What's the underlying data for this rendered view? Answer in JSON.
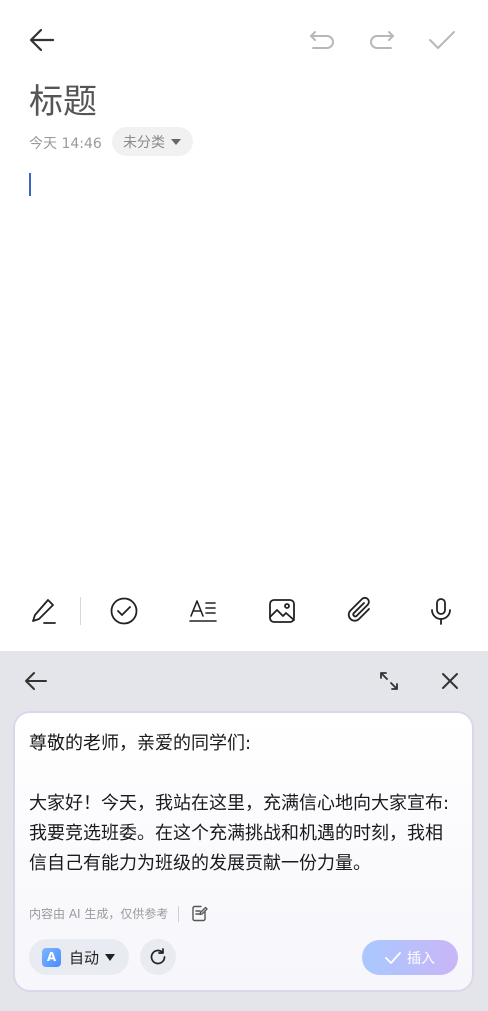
{
  "header": {
    "back_icon": "arrow-left-icon",
    "undo_icon": "undo-icon",
    "redo_icon": "redo-icon",
    "done_icon": "check-icon"
  },
  "note": {
    "title": "标题",
    "time": "今天 14:46",
    "category": "未分类",
    "body": ""
  },
  "toolbar": {
    "items": [
      "handwriting-icon",
      "checklist-icon",
      "text-format-icon",
      "image-icon",
      "attachment-icon",
      "microphone-icon"
    ]
  },
  "ai_panel": {
    "back_icon": "arrow-left-icon",
    "expand_icon": "expand-icon",
    "close_icon": "close-icon",
    "generated_text": "尊敬的老师，亲爱的同学们:\n\n大家好！今天，我站在这里，充满信心地向大家宣布:我要竞选班委。在这个充满挑战和机遇的时刻，我相信自己有能力为班级的发展贡献一份力量。",
    "ai_note": "内容由 AI 生成，仅供参考",
    "mode_badge": "A",
    "mode_label": "自动",
    "insert_label": "插入"
  },
  "colors": {
    "accent": "#3b63c8",
    "panel_bg": "#e4e5ea",
    "insert_gradient_start": "#a9c8ff",
    "insert_gradient_end": "#c9b6f7"
  }
}
